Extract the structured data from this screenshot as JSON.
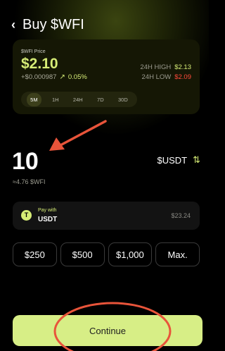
{
  "header": {
    "back_icon": "chevron-left",
    "title": "Buy $WFI"
  },
  "price_card": {
    "label": "$WFI Price",
    "price": "$2.10",
    "change_abs": "+$0.000987",
    "trend_icon": "trending-up",
    "change_pct": "0.05%",
    "high_label": "24H HIGH",
    "high_value": "$2.13",
    "low_label": "24H LOW",
    "low_value": "$2.09",
    "ranges": [
      "5M",
      "1H",
      "24H",
      "7D",
      "30D"
    ],
    "selected_range": "5M"
  },
  "amount": {
    "value": "10",
    "currency": "$USDT",
    "swap_icon": "swap-vertical",
    "equivalent": "≈4.76 $WFI"
  },
  "pay": {
    "icon_letter": "T",
    "label": "Pay with",
    "token": "USDT",
    "balance": "$23.24"
  },
  "presets": [
    "$250",
    "$500",
    "$1,000",
    "Max."
  ],
  "continue_label": "Continue",
  "colors": {
    "accent": "#d6ec76",
    "negative": "#ff4a3a",
    "annotation": "#e8543a",
    "background": "#000000"
  }
}
